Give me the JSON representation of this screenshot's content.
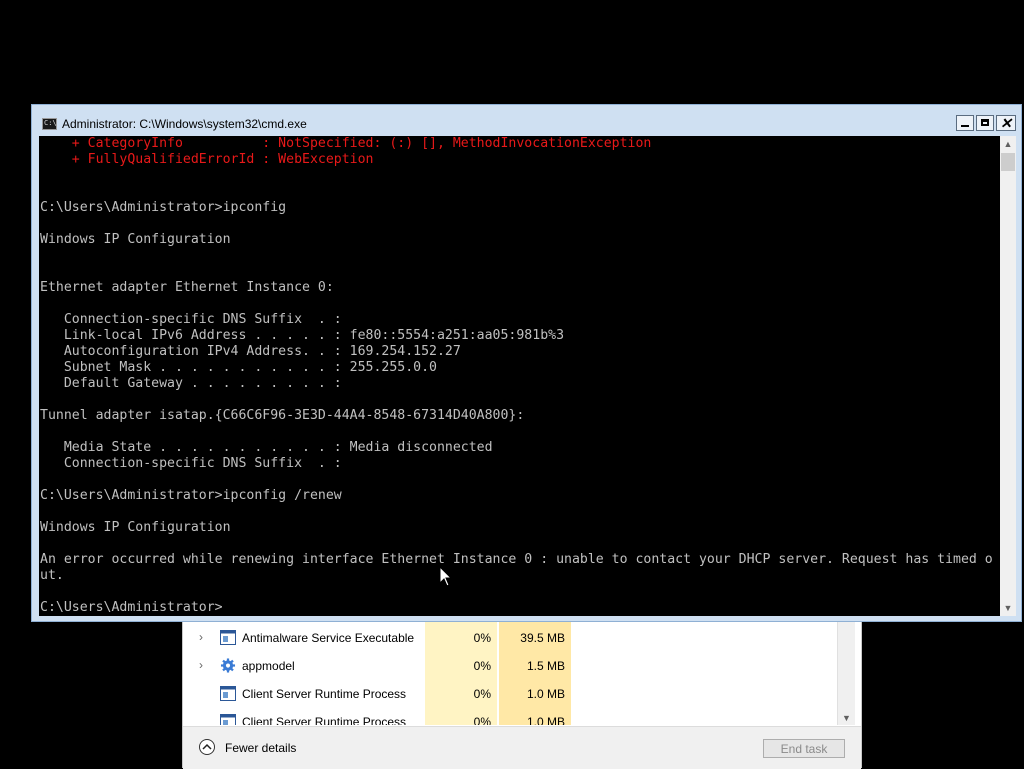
{
  "cmd_window": {
    "title": "Administrator: C:\\Windows\\system32\\cmd.exe",
    "icon_label": "C:\\",
    "close_glyph": "✕",
    "lines": [
      {
        "text": "    + CategoryInfo          : NotSpecified: (:) [], MethodInvocationException",
        "type": "err"
      },
      {
        "text": "    + FullyQualifiedErrorId : WebException",
        "type": "err"
      },
      {
        "text": "",
        "type": "out"
      },
      {
        "text": "",
        "type": "out"
      },
      {
        "text": "C:\\Users\\Administrator>ipconfig",
        "type": "out"
      },
      {
        "text": "",
        "type": "out"
      },
      {
        "text": "Windows IP Configuration",
        "type": "out"
      },
      {
        "text": "",
        "type": "out"
      },
      {
        "text": "",
        "type": "out"
      },
      {
        "text": "Ethernet adapter Ethernet Instance 0:",
        "type": "out"
      },
      {
        "text": "",
        "type": "out"
      },
      {
        "text": "   Connection-specific DNS Suffix  . :",
        "type": "out"
      },
      {
        "text": "   Link-local IPv6 Address . . . . . : fe80::5554:a251:aa05:981b%3",
        "type": "out"
      },
      {
        "text": "   Autoconfiguration IPv4 Address. . : 169.254.152.27",
        "type": "out"
      },
      {
        "text": "   Subnet Mask . . . . . . . . . . . : 255.255.0.0",
        "type": "out"
      },
      {
        "text": "   Default Gateway . . . . . . . . . :",
        "type": "out"
      },
      {
        "text": "",
        "type": "out"
      },
      {
        "text": "Tunnel adapter isatap.{C66C6F96-3E3D-44A4-8548-67314D40A800}:",
        "type": "out"
      },
      {
        "text": "",
        "type": "out"
      },
      {
        "text": "   Media State . . . . . . . . . . . : Media disconnected",
        "type": "out"
      },
      {
        "text": "   Connection-specific DNS Suffix  . :",
        "type": "out"
      },
      {
        "text": "",
        "type": "out"
      },
      {
        "text": "C:\\Users\\Administrator>ipconfig /renew",
        "type": "out"
      },
      {
        "text": "",
        "type": "out"
      },
      {
        "text": "Windows IP Configuration",
        "type": "out"
      },
      {
        "text": "",
        "type": "out"
      },
      {
        "text": "An error occurred while renewing interface Ethernet Instance 0 : unable to contact your DHCP server. Request has timed o",
        "type": "out"
      },
      {
        "text": "ut.",
        "type": "out"
      },
      {
        "text": "",
        "type": "out"
      },
      {
        "text": "C:\\Users\\Administrator>",
        "type": "out"
      }
    ]
  },
  "task_manager": {
    "processes": [
      {
        "name": "Antimalware Service Executable",
        "cpu": "0%",
        "memory": "39.5 MB",
        "expandable": true,
        "icon": "app-window-icon"
      },
      {
        "name": "appmodel",
        "cpu": "0%",
        "memory": "1.5 MB",
        "expandable": true,
        "icon": "gear-icon"
      },
      {
        "name": "Client Server Runtime Process",
        "cpu": "0%",
        "memory": "1.0 MB",
        "expandable": false,
        "icon": "app-window-icon"
      },
      {
        "name": "Client Server Runtime Process",
        "cpu": "0%",
        "memory": "1.0 MB",
        "expandable": false,
        "icon": "app-window-icon"
      }
    ],
    "fewer_details_label": "Fewer details",
    "end_task_label": "End task",
    "expand_glyph": "›"
  },
  "colors": {
    "terminal_bg": "#000000",
    "terminal_fg": "#c0c0c0",
    "error_fg": "#e81919",
    "cpu_column": "#fff4c4",
    "memory_column": "#ffe8a6"
  }
}
